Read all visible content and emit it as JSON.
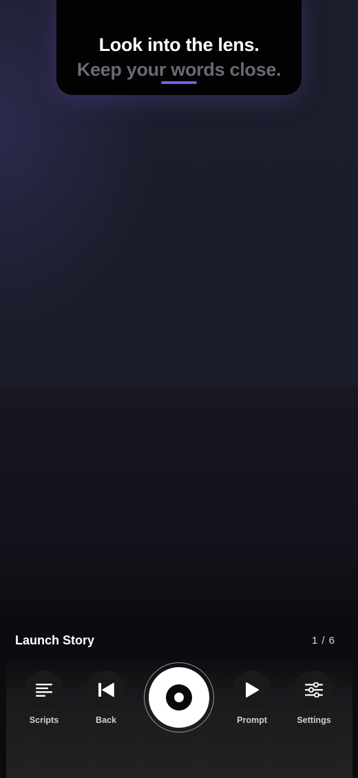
{
  "prompter": {
    "current_line": "Look into the lens.",
    "next_line": "Keep your words close."
  },
  "script": {
    "title": "Launch Story",
    "page_counter": "1 / 6"
  },
  "controls": {
    "scripts_label": "Scripts",
    "back_label": "Back",
    "prompt_label": "Prompt",
    "settings_label": "Settings"
  },
  "icons": {
    "scripts": "list-icon",
    "back": "skip-back-icon",
    "record": "record-icon",
    "prompt": "play-icon",
    "settings": "sliders-icon"
  },
  "colors": {
    "accent": "#7b5be8",
    "record_button": "#ffffff"
  }
}
